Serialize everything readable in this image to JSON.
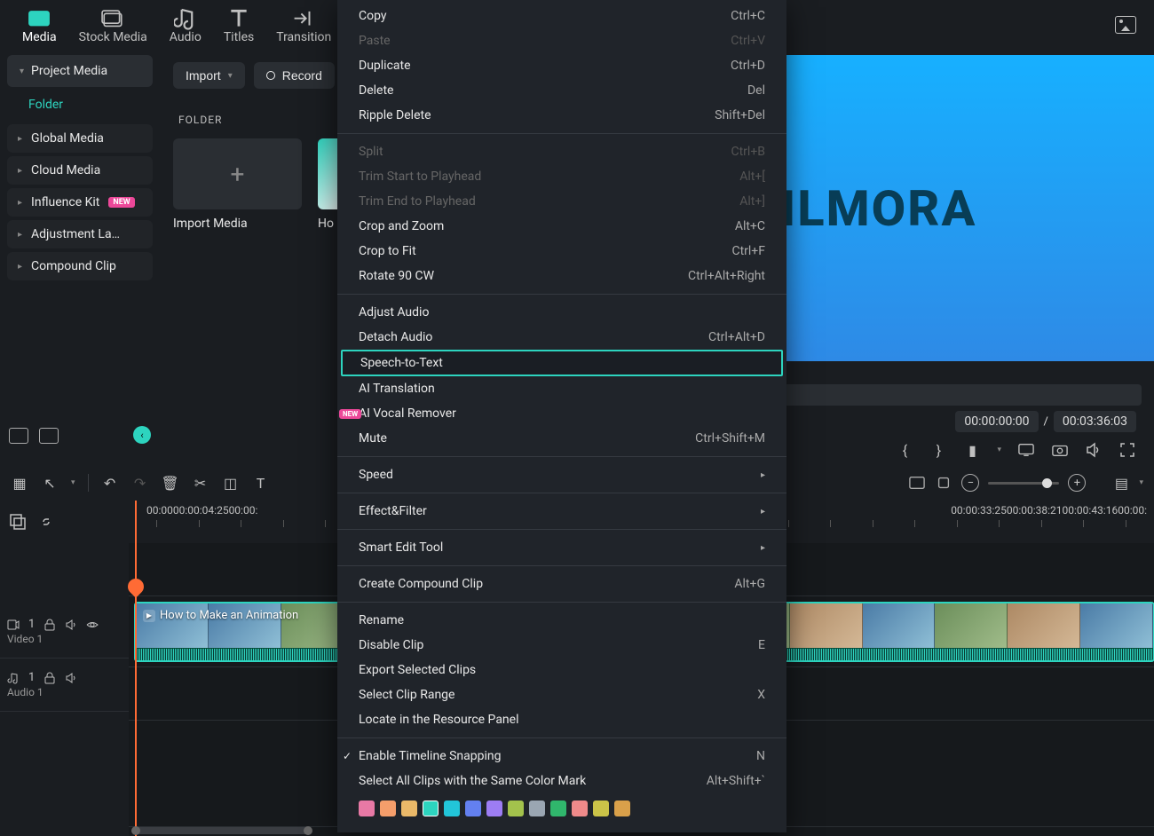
{
  "tabs": {
    "media": "Media",
    "stock_media": "Stock Media",
    "audio": "Audio",
    "titles": "Titles",
    "transitions": "Transition"
  },
  "sidebar": {
    "project_media": "Project Media",
    "folder": "Folder",
    "items": {
      "global_media": "Global Media",
      "cloud_media": "Cloud Media",
      "influence_kit": "Influence Kit",
      "influence_kit_badge": "NEW",
      "adjustment_layer": "Adjustment La…",
      "compound_clip": "Compound Clip"
    }
  },
  "center": {
    "import": "Import",
    "record": "Record",
    "folder_section": "FOLDER",
    "import_media": "Import Media",
    "thumb_label": "Ho"
  },
  "preview": {
    "brand_text": "ILMORA",
    "current_time": "00:00:00:00",
    "sep": "/",
    "duration": "00:03:36:03"
  },
  "ruler": [
    "00:00",
    "00:00:04:25",
    "00:00:",
    "00:00:33:25",
    "00:00:38:21",
    "00:00:43:16",
    "00:00:"
  ],
  "tracks": {
    "video1": "Video 1",
    "video1_num": "1",
    "audio1": "Audio 1",
    "audio1_num": "1",
    "clip_title": "How to Make an Animation"
  },
  "context_menu": {
    "copy": {
      "label": "Copy",
      "shortcut": "Ctrl+C"
    },
    "paste": {
      "label": "Paste",
      "shortcut": "Ctrl+V"
    },
    "duplicate": {
      "label": "Duplicate",
      "shortcut": "Ctrl+D"
    },
    "delete": {
      "label": "Delete",
      "shortcut": "Del"
    },
    "ripple_delete": {
      "label": "Ripple Delete",
      "shortcut": "Shift+Del"
    },
    "split": {
      "label": "Split",
      "shortcut": "Ctrl+B"
    },
    "trim_start": {
      "label": "Trim Start to Playhead",
      "shortcut": "Alt+["
    },
    "trim_end": {
      "label": "Trim End to Playhead",
      "shortcut": "Alt+]"
    },
    "crop_zoom": {
      "label": "Crop and Zoom",
      "shortcut": "Alt+C"
    },
    "crop_fit": {
      "label": "Crop to Fit",
      "shortcut": "Ctrl+F"
    },
    "rotate_90": {
      "label": "Rotate 90 CW",
      "shortcut": "Ctrl+Alt+Right"
    },
    "adjust_audio": {
      "label": "Adjust Audio",
      "shortcut": ""
    },
    "detach_audio": {
      "label": "Detach Audio",
      "shortcut": "Ctrl+Alt+D"
    },
    "speech_to_text": {
      "label": "Speech-to-Text",
      "shortcut": ""
    },
    "ai_translation": {
      "label": "AI Translation",
      "shortcut": ""
    },
    "ai_vocal_remover": {
      "label": "AI Vocal Remover",
      "shortcut": ""
    },
    "mute": {
      "label": "Mute",
      "shortcut": "Ctrl+Shift+M"
    },
    "speed": {
      "label": "Speed",
      "shortcut": ""
    },
    "effect_filter": {
      "label": "Effect&Filter",
      "shortcut": ""
    },
    "smart_edit": {
      "label": "Smart Edit Tool",
      "shortcut": ""
    },
    "create_compound": {
      "label": "Create Compound Clip",
      "shortcut": "Alt+G"
    },
    "rename": {
      "label": "Rename",
      "shortcut": ""
    },
    "disable_clip": {
      "label": "Disable Clip",
      "shortcut": "E"
    },
    "export_selected": {
      "label": "Export Selected Clips",
      "shortcut": ""
    },
    "select_clip_range": {
      "label": "Select Clip Range",
      "shortcut": "X"
    },
    "locate_resource": {
      "label": "Locate in the Resource Panel",
      "shortcut": ""
    },
    "timeline_snapping": {
      "label": "Enable Timeline Snapping",
      "shortcut": "N"
    },
    "select_all_color": {
      "label": "Select All Clips with the Same Color Mark",
      "shortcut": "Alt+Shift+`"
    }
  },
  "color_marks": [
    "#e879a5",
    "#f59e6b",
    "#eab969",
    "#2dd4bf",
    "#22c5d9",
    "#6380f0",
    "#9d7df3",
    "#a3c24c",
    "#9aa6b2",
    "#30b66c",
    "#ef8a8a",
    "#cbc348",
    "#d9a04a"
  ]
}
